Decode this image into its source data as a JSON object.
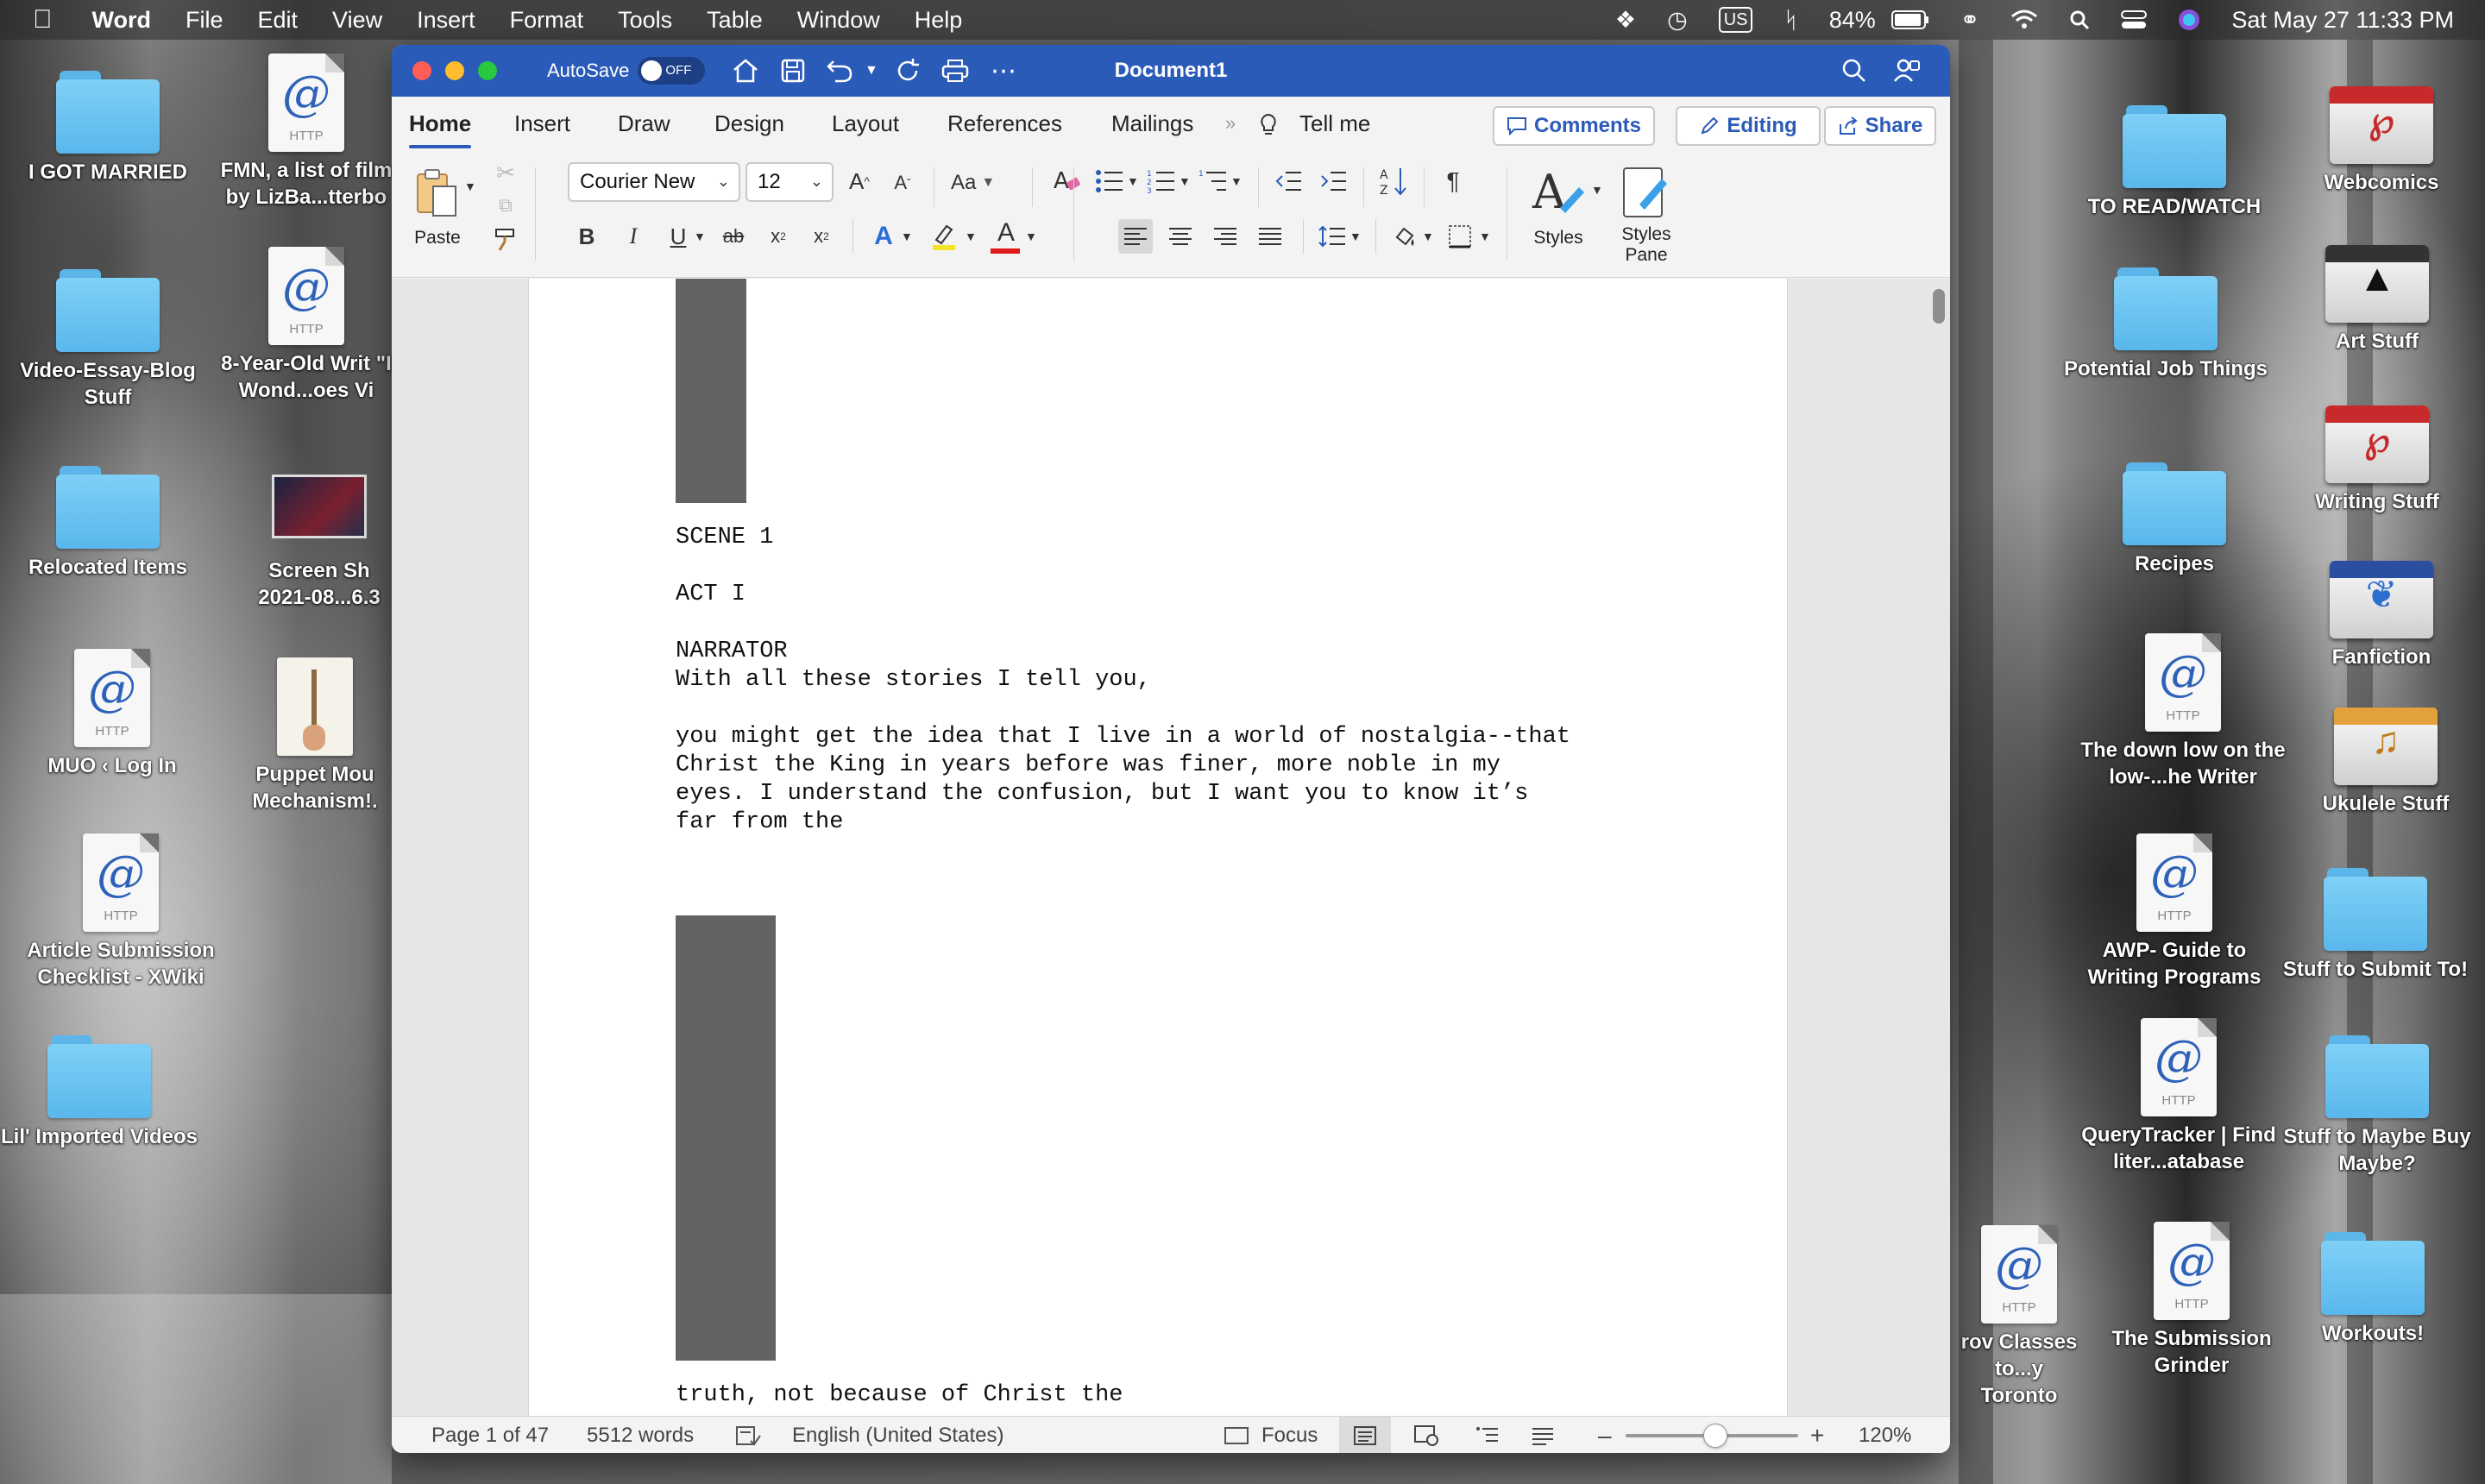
{
  "menubar": {
    "app": "Word",
    "items": [
      "File",
      "Edit",
      "View",
      "Insert",
      "Format",
      "Tools",
      "Table",
      "Window",
      "Help"
    ],
    "battery": "84%",
    "input_source": "US",
    "datetime": "Sat May 27  11:33 PM"
  },
  "desktop_left": [
    {
      "label": "I GOT MARRIED",
      "type": "folder"
    },
    {
      "label": "FMN, a list of film by LizBa...tterbo",
      "type": "http"
    },
    {
      "label": "Video-Essay-Blog Stuff",
      "type": "folder"
    },
    {
      "label": "8-Year-Old Writ \"I Wond...oes Vi",
      "type": "http"
    },
    {
      "label": "Relocated Items",
      "type": "folder"
    },
    {
      "label": "Screen Sh 2021-08...6.3",
      "type": "screenshot"
    },
    {
      "label": "MUO ‹ Log In",
      "type": "http"
    },
    {
      "label": "Puppet Mou Mechanism!.",
      "type": "puppet"
    },
    {
      "label": "Article Submission Checklist - XWiki",
      "type": "http"
    },
    {
      "label": "Lil' Imported Videos",
      "type": "folder"
    }
  ],
  "desktop_right": [
    {
      "label": "TO READ/WATCH",
      "type": "folder"
    },
    {
      "label": "Webcomics",
      "type": "drawer"
    },
    {
      "label": "Potential Job Things",
      "type": "folder"
    },
    {
      "label": "Art Stuff",
      "type": "drawer"
    },
    {
      "label": "Writing Stuff",
      "type": "drawer"
    },
    {
      "label": "Recipes",
      "type": "folder"
    },
    {
      "label": "Fanfiction",
      "type": "drawer"
    },
    {
      "label": "The down low on the low-...he Writer",
      "type": "http"
    },
    {
      "label": "Ukulele Stuff",
      "type": "drawer"
    },
    {
      "label": "AWP- Guide to Writing Programs",
      "type": "http"
    },
    {
      "label": "Stuff to Submit To!",
      "type": "folder"
    },
    {
      "label": "QueryTracker | Find liter...atabase",
      "type": "http"
    },
    {
      "label": "Stuff to Maybe Buy Maybe?",
      "type": "folder"
    },
    {
      "label": "rov Classes to...y Toronto",
      "type": "http"
    },
    {
      "label": "The Submission Grinder",
      "type": "http"
    },
    {
      "label": "Workouts!",
      "type": "folder"
    }
  ],
  "http_badge": "HTTP",
  "word": {
    "autosave_label": "AutoSave",
    "autosave_state": "OFF",
    "doc_title": "Document1",
    "tabs": [
      "Home",
      "Insert",
      "Draw",
      "Design",
      "Layout",
      "References",
      "Mailings"
    ],
    "tell_me": "Tell me",
    "comments": "Comments",
    "editing": "Editing",
    "share": "Share",
    "paste": "Paste",
    "font_name": "Courier New",
    "font_size": "12",
    "change_case": "Aa",
    "styles": "Styles",
    "styles_pane_1": "Styles",
    "styles_pane_2": "Pane",
    "accent": "#2b5bb8"
  },
  "document": {
    "lines_a": [
      "SCENE 1",
      "",
      "ACT I",
      "",
      "NARRATOR",
      "With all these stories I tell you,",
      "",
      "you might get the idea that I live in a world of nostalgia--that",
      "Christ the King in years before was finer, more noble in my",
      "eyes. I understand the confusion, but I want you to know it’s",
      "far from the"
    ],
    "line_b": "truth, not because of Christ the"
  },
  "status": {
    "page": "Page 1 of 47",
    "words": "5512 words",
    "language": "English (United States)",
    "focus": "Focus",
    "zoom": "120%"
  }
}
